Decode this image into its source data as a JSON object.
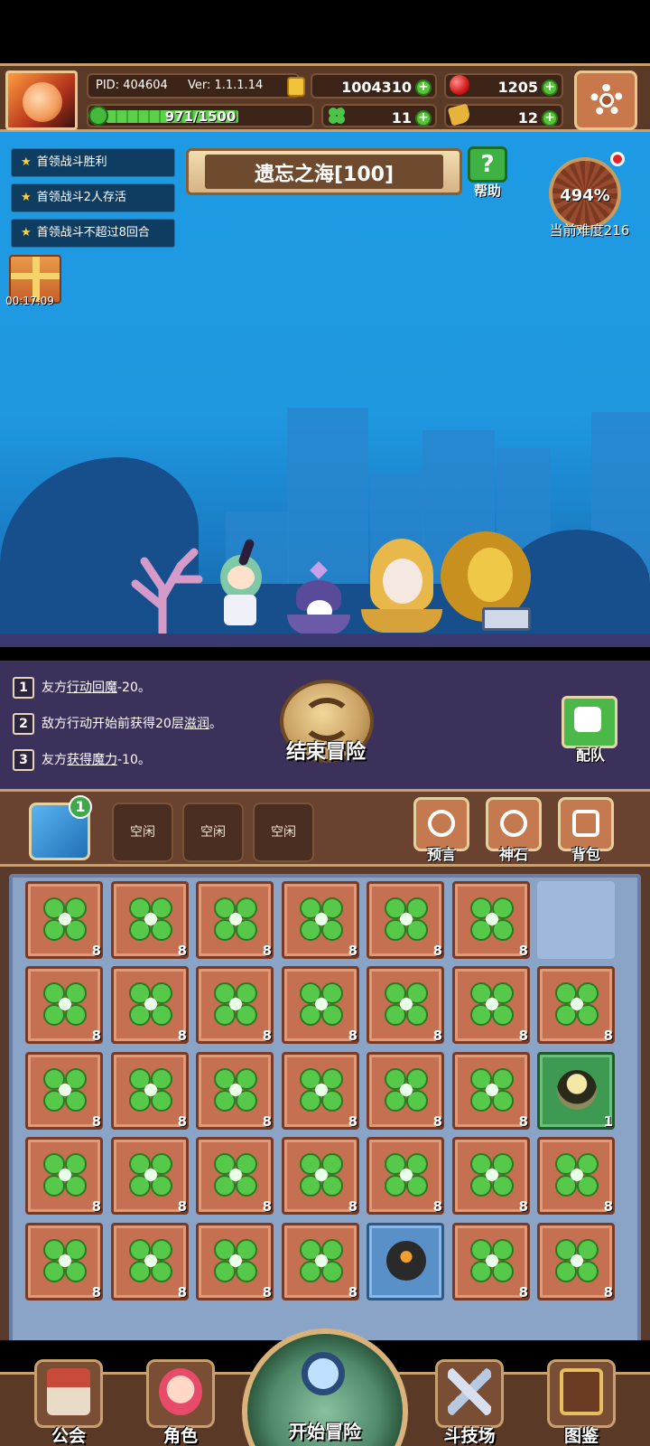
{
  "header": {
    "pid_label": "PID: 404604",
    "version_label": "Ver: 1.1.1.14",
    "coins": "1004310",
    "gems": "1205",
    "xp": "971/1500",
    "xp_fraction": 0.647,
    "clovers": "11",
    "keys": "12"
  },
  "quests": [
    {
      "label": "首领战斗胜利"
    },
    {
      "label": "首领战斗2人存活"
    },
    {
      "label": "首领战斗不超过8回合"
    }
  ],
  "gift": {
    "timer": "00:17:09"
  },
  "stage": {
    "title": "遗忘之海[100]",
    "help_label": "帮助"
  },
  "difficulty": {
    "percent": "494%",
    "label": "当前难度216"
  },
  "log": [
    {
      "num": "1",
      "pre": "友方",
      "hl": "行动回魔",
      "post": "-20。"
    },
    {
      "num": "2",
      "pre": "敌方行动开始前获得20层",
      "hl": "滋润",
      "post": "。"
    },
    {
      "num": "3",
      "pre": "友方",
      "hl": "获得魔力",
      "post": "-10。"
    }
  ],
  "end_button": "结束冒险",
  "team_button": "配队",
  "map_badge": "1",
  "slots": [
    "空闲",
    "空闲",
    "空闲"
  ],
  "ctrl_buttons": [
    {
      "label": "预言"
    },
    {
      "label": "神石"
    },
    {
      "label": "背包"
    }
  ],
  "inventory": [
    [
      "8",
      "8",
      "8",
      "8",
      "8",
      "8",
      ""
    ],
    [
      "8",
      "8",
      "8",
      "8",
      "8",
      "8",
      "8"
    ],
    [
      "8",
      "8",
      "8",
      "8",
      "8",
      "8",
      "1"
    ],
    [
      "8",
      "8",
      "8",
      "8",
      "8",
      "8",
      "8"
    ],
    [
      "8",
      "8",
      "8",
      "8",
      "",
      "8",
      "8"
    ]
  ],
  "nav": {
    "guild": "公会",
    "character": "角色",
    "start": "开始冒险",
    "arena": "斗技场",
    "codex": "图鉴"
  }
}
